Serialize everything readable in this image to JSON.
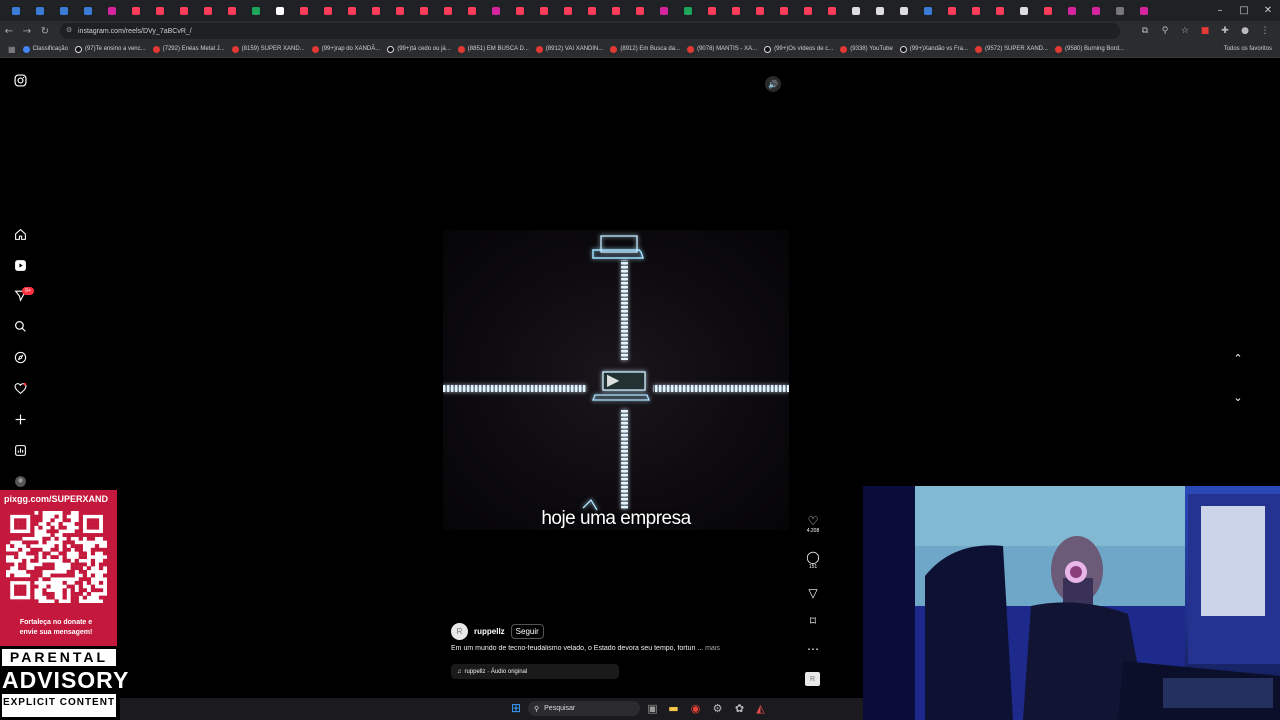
{
  "browser": {
    "url": "instagram.com/reels/DVy_7aBCvR_/",
    "bookmarks": [
      {
        "label": "Classificação",
        "icon": "google"
      },
      {
        "label": "(97)Te ensino a venc...",
        "icon": "tiktok"
      },
      {
        "label": "(7292) Enéas Metal J...",
        "icon": "youtube"
      },
      {
        "label": "(8159) SUPER XAND...",
        "icon": "youtube"
      },
      {
        "label": "(99+)rap do XANDÃ...",
        "icon": "youtube"
      },
      {
        "label": "(99+)tá cedo ou já...",
        "icon": "tiktok"
      },
      {
        "label": "(8851) EM BUSCA D...",
        "icon": "youtube"
      },
      {
        "label": "(8912) VAI XANDIN...",
        "icon": "youtube"
      },
      {
        "label": "(8912) Em Busca da...",
        "icon": "youtube"
      },
      {
        "label": "(9078) MANTIS - XA...",
        "icon": "youtube"
      },
      {
        "label": "(99+)Os vídeos de c...",
        "icon": "tiktok"
      },
      {
        "label": "(9338) YouTube",
        "icon": "youtube"
      },
      {
        "label": "(99+)Xandão vs Fra...",
        "icon": "tiktok"
      },
      {
        "label": "(9572) SUPER XAND...",
        "icon": "youtube"
      },
      {
        "label": "(9580) Burning Bord...",
        "icon": "youtube"
      }
    ],
    "all_bookmarks": "Todos os favoritos"
  },
  "instagram": {
    "notification_badge": "9+",
    "reel": {
      "caption": "hoje uma empresa",
      "author": "ruppellz",
      "avatar_initial": "R",
      "follow_label": "Seguir",
      "description": "Em um mundo de tecno-feudalismo velado, o Estado devora seu tempo, fortun ...",
      "more_label": "mais",
      "audio": "ruppellz · Áudio original"
    },
    "actions": {
      "likes": "4.208",
      "comments": "151"
    }
  },
  "stream_overlay": {
    "pix_url": "pixgg.com/SUPERXAND",
    "pix_message_1": "Fortaleça no donate e",
    "pix_message_2": "envie sua mensagem!",
    "advisory_line1": "PARENTAL",
    "advisory_line2": "ADVISORY",
    "advisory_line3": "EXPLICIT CONTENT"
  },
  "taskbar": {
    "search_placeholder": "Pesquisar"
  },
  "colors": {
    "instagram_badge": "#ff3040",
    "pix_background": "#c4183c",
    "neon_glow": "#8fd8ff"
  }
}
